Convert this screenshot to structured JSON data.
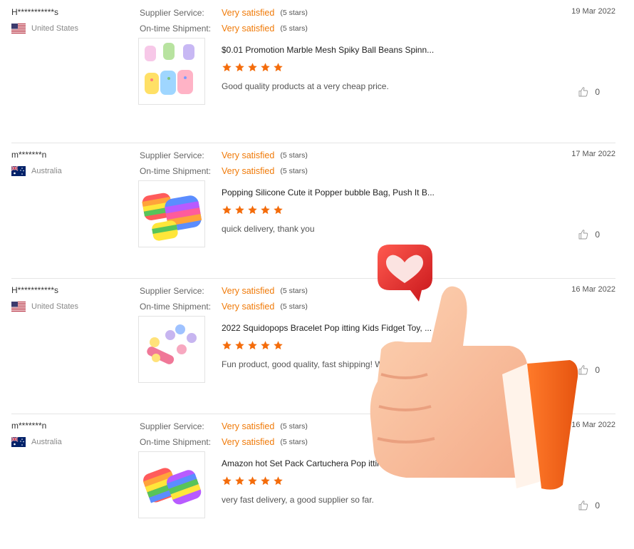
{
  "labels": {
    "supplier_service": "Supplier Service:",
    "on_time_shipment": "On-time Shipment:"
  },
  "reviews": [
    {
      "buyer": "H***********s",
      "country": "United States",
      "flag": "us-flag",
      "supplier_rating": "Very satisfied",
      "supplier_stars": "(5 stars)",
      "shipment_rating": "Very satisfied",
      "shipment_stars": "(5 stars)",
      "date": "19 Mar 2022",
      "product_title": "$0.01 Promotion Marble Mesh Spiky Ball Beans Spinn...",
      "product_stars": 5,
      "comment": "Good quality products at a very cheap price.",
      "likes": "0"
    },
    {
      "buyer": "m*******n",
      "country": "Australia",
      "flag": "au-flag",
      "supplier_rating": "Very satisfied",
      "supplier_stars": "(5 stars)",
      "shipment_rating": "Very satisfied",
      "shipment_stars": "(5 stars)",
      "date": "17 Mar 2022",
      "product_title": "Popping Silicone Cute it Popper bubble Bag, Push It B...",
      "product_stars": 5,
      "comment": "quick delivery, thank you",
      "likes": "0"
    },
    {
      "buyer": "H***********s",
      "country": "United States",
      "flag": "us-flag",
      "supplier_rating": "Very satisfied",
      "supplier_stars": "(5 stars)",
      "shipment_rating": "Very satisfied",
      "shipment_stars": "(5 stars)",
      "date": "16 Mar 2022",
      "product_title": "2022 Squidopops Bracelet Pop itting Kids Fidget Toy, ...",
      "product_stars": 5,
      "comment": "Fun product, good quality, fast shipping! W",
      "likes": "0"
    },
    {
      "buyer": "m*******n",
      "country": "Australia",
      "flag": "au-flag",
      "supplier_rating": "Very satisfied",
      "supplier_stars": "(5 stars)",
      "shipment_rating": "Very satisfied",
      "shipment_stars": "(5 stars)",
      "date": "16 Mar 2022",
      "product_title": "Amazon hot Set Pack Cartuchera Pop itting, 2022 Pus...",
      "product_stars": 5,
      "comment": "very fast delivery, a good supplier so far.",
      "likes": "0"
    }
  ],
  "colors": {
    "accent": "#f07a08",
    "star": "#f46c0b",
    "heart_bubble": "#e8262b",
    "cuff": "#f2641a"
  }
}
